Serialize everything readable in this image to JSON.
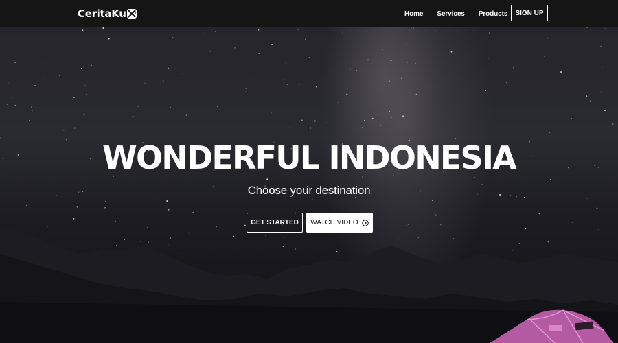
{
  "header": {
    "logo_text": "CeritaKu",
    "nav": [
      {
        "label": "Home"
      },
      {
        "label": "Services"
      },
      {
        "label": "Products"
      }
    ],
    "signup_label": "SIGN UP"
  },
  "hero": {
    "title": "WONDERFUL INDONESIA",
    "subtitle": "Choose your destination",
    "get_started_label": "GET STARTED",
    "watch_video_label": "WATCH VIDEO",
    "watch_video_icon": "play-circle-icon"
  },
  "colors": {
    "navbar_bg": "#161515",
    "text": "#ffffff",
    "tent_accent": "#c86fb8"
  }
}
